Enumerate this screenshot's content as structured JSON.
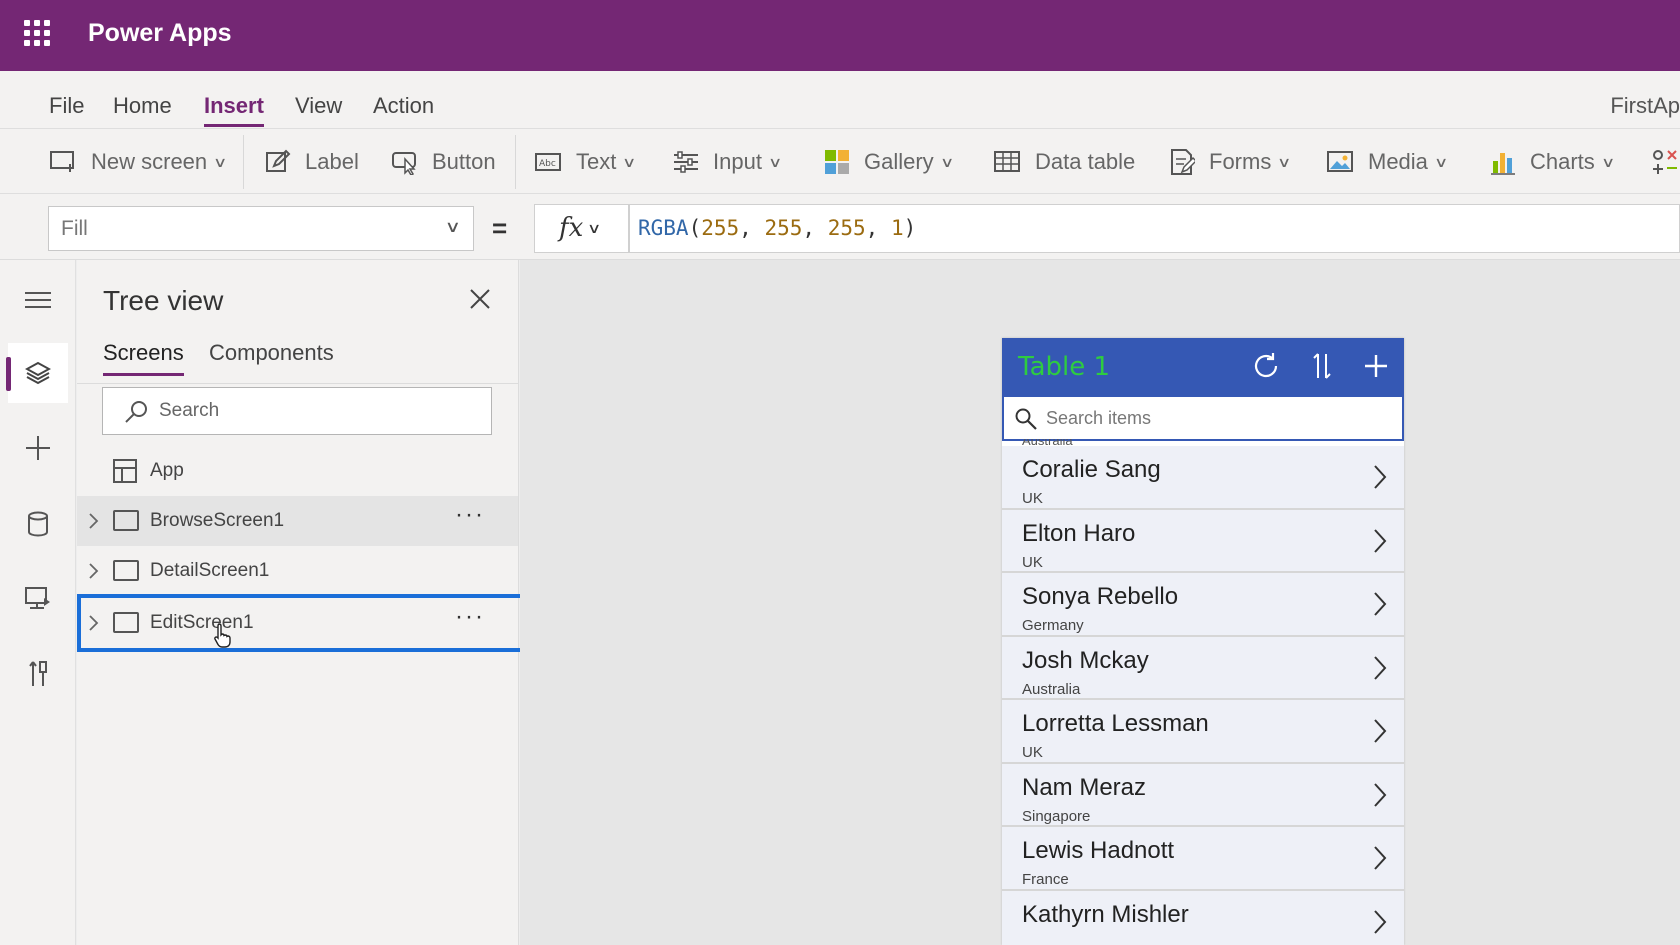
{
  "app": {
    "title": "Power Apps"
  },
  "menu": {
    "items": [
      {
        "label": "File"
      },
      {
        "label": "Home"
      },
      {
        "label": "Insert"
      },
      {
        "label": "View"
      },
      {
        "label": "Action"
      }
    ],
    "active": "Insert",
    "file_title": "FirstAp"
  },
  "ribbon": {
    "new_screen": "New screen",
    "label": "Label",
    "button": "Button",
    "text": "Text",
    "input": "Input",
    "gallery": "Gallery",
    "data_table": "Data table",
    "forms": "Forms",
    "media": "Media",
    "charts": "Charts"
  },
  "formula_bar": {
    "property": "Fill",
    "equals": "=",
    "fx": "fx",
    "formula_fn": "RGBA",
    "formula_open": "(",
    "r": "255",
    "g": "255",
    "b": "255",
    "a": "1",
    "formula_close": ")",
    "sep": ", "
  },
  "tree_view": {
    "title": "Tree view",
    "tabs": [
      {
        "label": "Screens"
      },
      {
        "label": "Components"
      }
    ],
    "search_placeholder": "Search",
    "app_item": "App",
    "screens": [
      {
        "label": "BrowseScreen1"
      },
      {
        "label": "DetailScreen1"
      },
      {
        "label": "EditScreen1"
      }
    ],
    "more": "···"
  },
  "preview": {
    "header_title": "Table 1",
    "search_placeholder": "Search items",
    "peek_text": "Australia",
    "rows": [
      {
        "name": "Coralie Sang",
        "country": "UK"
      },
      {
        "name": "Elton Haro",
        "country": "UK"
      },
      {
        "name": "Sonya Rebello",
        "country": "Germany"
      },
      {
        "name": "Josh Mckay",
        "country": "Australia"
      },
      {
        "name": "Lorretta Lessman",
        "country": "UK"
      },
      {
        "name": "Nam Meraz",
        "country": "Singapore"
      },
      {
        "name": "Lewis Hadnott",
        "country": "France"
      },
      {
        "name": "Kathyrn Mishler",
        "country": ""
      }
    ]
  },
  "colors": {
    "brand": "#742774",
    "selection": "#1a6ed8",
    "preview_header": "#3558b4",
    "preview_title": "#2ecc40"
  }
}
